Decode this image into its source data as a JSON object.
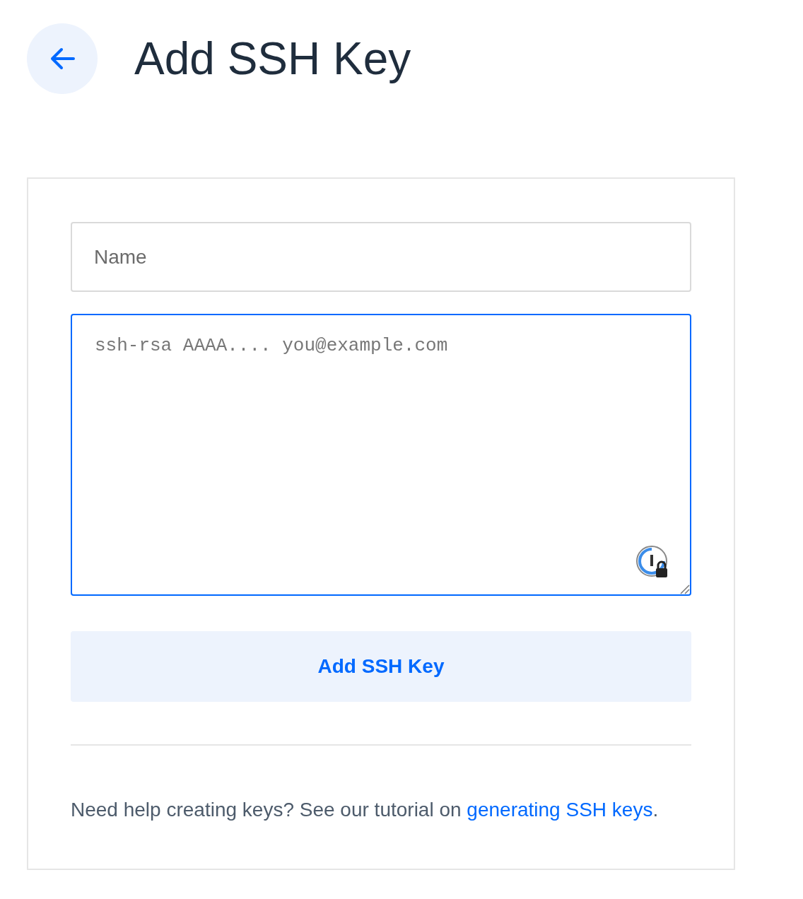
{
  "header": {
    "title": "Add SSH Key"
  },
  "form": {
    "name_field": {
      "placeholder": "Name"
    },
    "key_field": {
      "placeholder": "ssh-rsa AAAA.... you@example.com",
      "focused": true
    },
    "submit_button": "Add SSH Key"
  },
  "help": {
    "text_before": "Need help creating keys? See our tutorial on ",
    "link": "generating SSH keys",
    "text_after": "."
  }
}
